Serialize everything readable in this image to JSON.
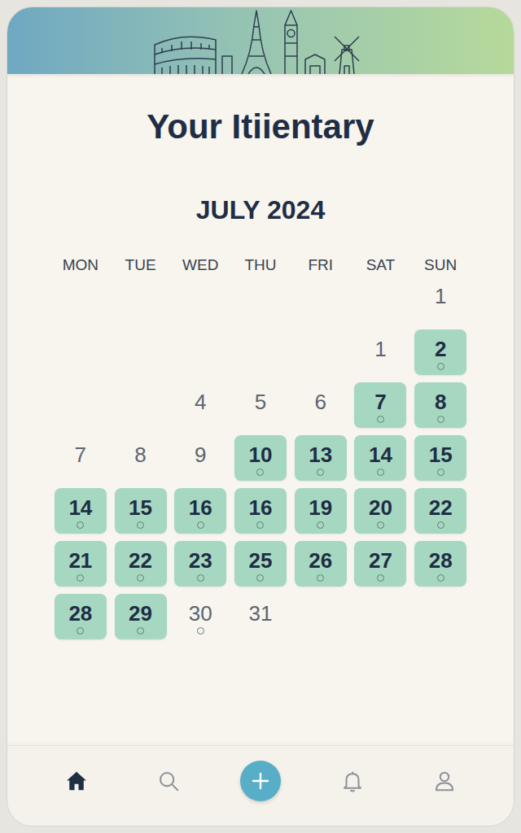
{
  "title": "Your Itiientary",
  "month": "JULY 2024",
  "weekdays": [
    "MON",
    "TUE",
    "WED",
    "THU",
    "FRI",
    "SAT",
    "SUN"
  ],
  "weeks": [
    [
      null,
      null,
      null,
      null,
      null,
      null,
      {
        "day": "1",
        "highlighted": false,
        "marked": false
      }
    ],
    [
      null,
      null,
      null,
      null,
      null,
      {
        "day": "1",
        "highlighted": false,
        "marked": false
      },
      {
        "day": "2",
        "highlighted": true,
        "marked": true
      }
    ],
    [
      null,
      null,
      {
        "day": "4",
        "highlighted": false,
        "marked": false
      },
      {
        "day": "5",
        "highlighted": false,
        "marked": false
      },
      {
        "day": "6",
        "highlighted": false,
        "marked": false
      },
      {
        "day": "7",
        "highlighted": true,
        "marked": true
      },
      {
        "day": "8",
        "highlighted": true,
        "marked": true
      }
    ],
    [
      {
        "day": "7",
        "highlighted": false,
        "marked": false
      },
      {
        "day": "8",
        "highlighted": false,
        "marked": false
      },
      {
        "day": "9",
        "highlighted": false,
        "marked": false
      },
      {
        "day": "10",
        "highlighted": true,
        "marked": true
      },
      {
        "day": "13",
        "highlighted": true,
        "marked": true
      },
      {
        "day": "14",
        "highlighted": true,
        "marked": true
      },
      {
        "day": "15",
        "highlighted": true,
        "marked": true
      }
    ],
    [
      {
        "day": "14",
        "highlighted": true,
        "marked": true
      },
      {
        "day": "15",
        "highlighted": true,
        "marked": true
      },
      {
        "day": "16",
        "highlighted": true,
        "marked": true
      },
      {
        "day": "16",
        "highlighted": true,
        "marked": true
      },
      {
        "day": "19",
        "highlighted": true,
        "marked": true
      },
      {
        "day": "20",
        "highlighted": true,
        "marked": true
      },
      {
        "day": "22",
        "highlighted": true,
        "marked": true
      }
    ],
    [
      {
        "day": "21",
        "highlighted": true,
        "marked": true
      },
      {
        "day": "22",
        "highlighted": true,
        "marked": true
      },
      {
        "day": "23",
        "highlighted": true,
        "marked": true
      },
      {
        "day": "25",
        "highlighted": true,
        "marked": true
      },
      {
        "day": "26",
        "highlighted": true,
        "marked": true
      },
      {
        "day": "27",
        "highlighted": true,
        "marked": true
      },
      {
        "day": "28",
        "highlighted": true,
        "marked": true
      }
    ],
    [
      {
        "day": "28",
        "highlighted": true,
        "marked": true
      },
      {
        "day": "29",
        "highlighted": true,
        "marked": true
      },
      {
        "day": "30",
        "highlighted": false,
        "marked": true
      },
      {
        "day": "31",
        "highlighted": false,
        "marked": false
      },
      null,
      null,
      null
    ]
  ],
  "nav": [
    {
      "kind": "tab",
      "selected": true
    },
    {
      "kind": "tab",
      "selected": false
    },
    {
      "kind": "action",
      "selected": false
    },
    {
      "kind": "tab",
      "selected": false
    },
    {
      "kind": "tab",
      "selected": false
    }
  ]
}
